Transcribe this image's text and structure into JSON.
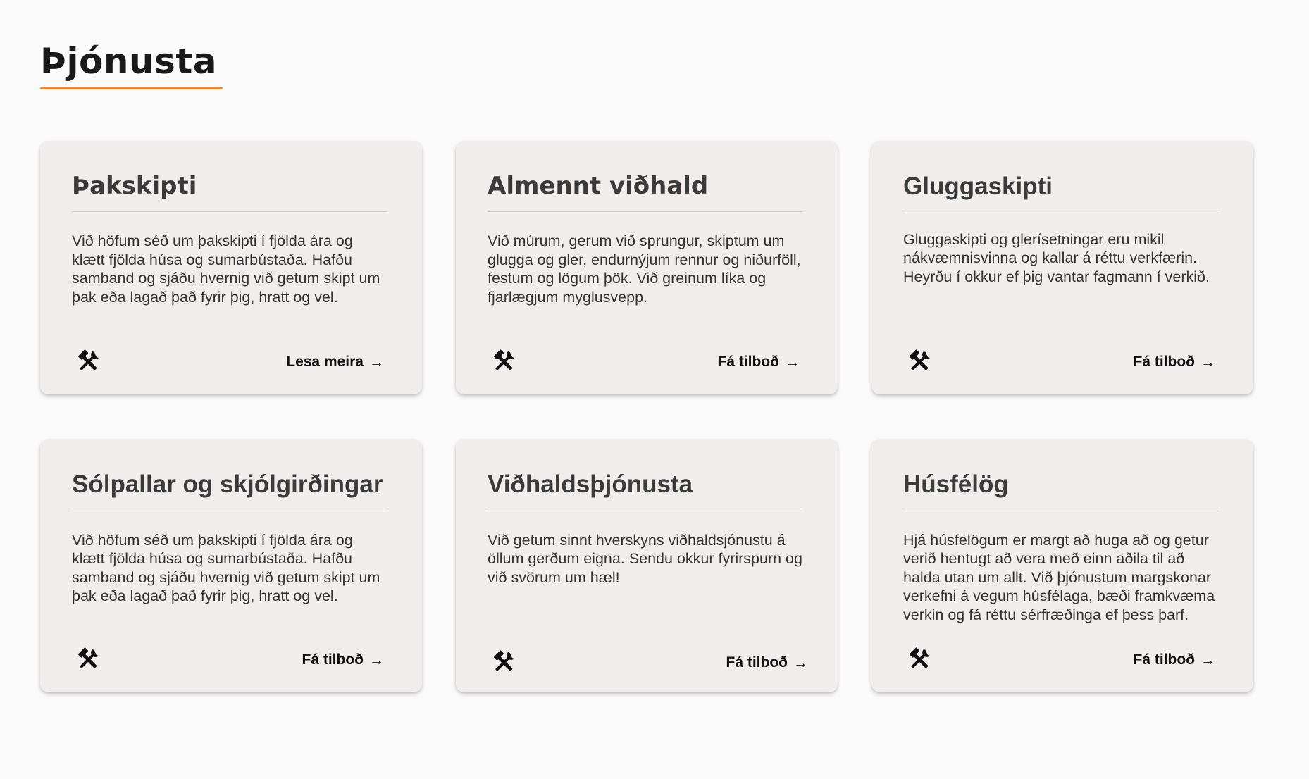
{
  "section": {
    "title": "Þjónusta"
  },
  "colors": {
    "accent": "#e8873a",
    "card_bg": "#f2eded",
    "page_bg": "#fafafa"
  },
  "cards": [
    {
      "title": "Þakskipti",
      "text": "Við höfum séð um þakskipti í fjölda ára og klætt fjölda húsa og sumarbústaða. Hafðu samband og sjáðu hvernig við getum skipt um þak eða lagað það fyrir þig, hratt og vel.",
      "icon": "hammer-wrench-icon",
      "link_label": "Lesa meira",
      "arrow": "→"
    },
    {
      "title": "Almennt viðhald",
      "text": "Við múrum, gerum við sprungur, skiptum um glugga og gler, endurnýjum rennur og niðurföll, festum og lögum þök. Við greinum líka og fjarlægjum myglusvepp.",
      "icon": "hammer-wrench-icon",
      "link_label": "Fá tilboð",
      "arrow": "→"
    },
    {
      "title": "Gluggaskipti",
      "text": "Gluggaskipti og glerísetningar eru mikil nákvæmnisvinna og kallar á réttu verkfærin. Heyrðu í okkur ef þig vantar fagmann í verkið.",
      "icon": "hammer-wrench-icon",
      "link_label": "Fá tilboð",
      "arrow": "→"
    },
    {
      "title": "Sólpallar og skjólgirðingar",
      "text": "Við höfum séð um þakskipti í fjölda ára og klætt fjölda húsa og sumarbústaða. Hafðu samband og sjáðu hvernig við getum skipt um þak eða lagað það fyrir þig, hratt og vel.",
      "icon": "hammer-wrench-icon",
      "link_label": "Fá tilboð",
      "arrow": "→"
    },
    {
      "title": "Viðhaldsþjónusta",
      "text": "Við getum sinnt hverskyns viðhaldsjónustu á öllum gerðum eigna. Sendu okkur fyrirspurn og við svörum um hæl!",
      "icon": "hammer-wrench-icon",
      "link_label": "Fá tilboð",
      "arrow": "→"
    },
    {
      "title": "Húsfélög",
      "text": "Hjá húsfelögum er margt að huga að og getur verið hentugt að vera með einn aðila til að halda utan um allt. Við þjónustum margskonar verkefni á vegum húsfélaga, bæði framkvæma verkin og fá réttu sérfræðinga ef þess þarf.",
      "icon": "hammer-wrench-icon",
      "link_label": "Fá tilboð",
      "arrow": "→"
    }
  ]
}
